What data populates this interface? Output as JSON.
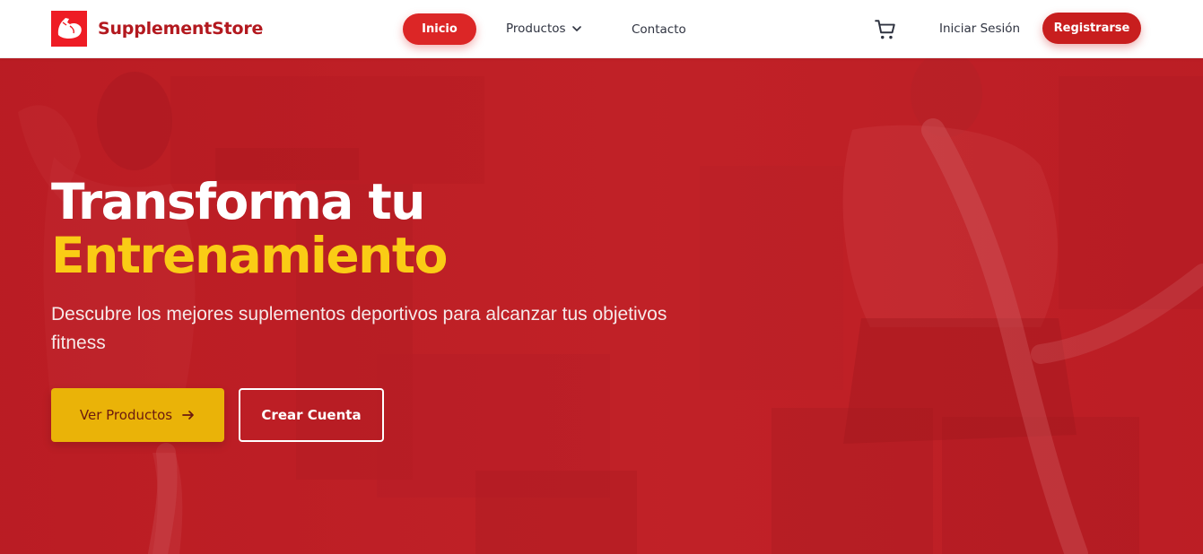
{
  "brand": {
    "name": "SupplementStore",
    "logo_icon": "flexed-bicep-icon",
    "logo_color": "#ee1c24",
    "name_color": "#b3191f"
  },
  "nav": {
    "items": [
      {
        "label": "Inicio",
        "active": true
      },
      {
        "label": "Productos",
        "has_dropdown": true,
        "icon": "chevron-down-icon"
      },
      {
        "label": "Contacto"
      }
    ],
    "active_color": "#dc2626"
  },
  "header_actions": {
    "cart_icon": "shopping-cart-icon",
    "login_label": "Iniciar Sesión",
    "register_label": "Registrarse"
  },
  "hero": {
    "title_line1": "Transforma tu",
    "title_line2": "Entrenamiento",
    "subtitle": "Descubre los mejores suplementos deportivos para alcanzar tus objetivos fitness",
    "primary_button": "Ver Productos",
    "primary_icon": "arrow-right-icon",
    "secondary_button": "Crear Cuenta",
    "accent_color": "#facc15",
    "overlay_color": "#c2242a",
    "button_color": "#eab308"
  }
}
